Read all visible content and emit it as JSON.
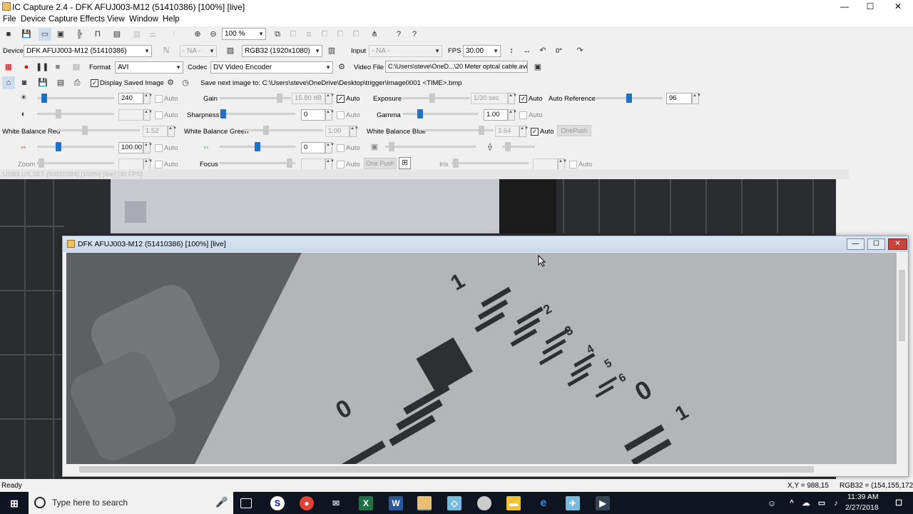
{
  "app": {
    "title": "IC Capture 2.4 - DFK AFUJ003-M12 (51410386) [100%]  [live]",
    "window_buttons": {
      "minimize": "—",
      "maximize": "☐",
      "close": "✕"
    }
  },
  "menu": [
    "File",
    "Device",
    "Capture",
    "Effects",
    "View",
    "Window",
    "Help"
  ],
  "toolbar1": {
    "zoom": "100 %"
  },
  "toolbar2": {
    "device_label": "Device",
    "device_value": "DFK AFUJ003-M12 (51410386)",
    "format_na": "- NA -",
    "color_format": "RGB32 (1920x1080)",
    "input_label": "Input",
    "input_value": "- NA -",
    "fps_label": "FPS",
    "fps_value": "30.00",
    "rotation": "0°"
  },
  "toolbar3": {
    "format_label": "Format",
    "format_value": "AVI",
    "codec_label": "Codec",
    "codec_value": "DV Video Encoder",
    "videofile_label": "Video File",
    "videofile_value": "C:\\Users\\steve\\OneD...\\20 Meter optcal cable.avi"
  },
  "toolbar4": {
    "display_saved": "Display Saved Image",
    "save_next": "Save next image to: C:\\Users\\steve\\OneDrive\\Desktop\\trigger\\Image0001 <TIME>.bmp"
  },
  "props": {
    "brightness_value": "240",
    "auto": "Auto",
    "gain_label": "Gain",
    "gain_value": "15.80 dB",
    "exposure_label": "Exposure",
    "exposure_value": "1/30 sec",
    "auto_ref_label": "Auto Reference",
    "auto_ref_value": "96",
    "sharpness_label": "Sharpness",
    "sharpness_value": "0",
    "gamma_label": "Gamma",
    "gamma_value": "1.00",
    "wb_red_label": "White Balance Red",
    "wb_red_value": "1.52",
    "wb_green_label": "White Balance Green",
    "wb_green_value": "1.00",
    "wb_blue_label": "White Balance Blue",
    "wb_blue_value": "3.64",
    "onepush": "OnePush",
    "saturation_value": "100.00",
    "hue_value": "0",
    "zoom_label": "Zoom",
    "focus_label": "Focus",
    "one_push": "One Push",
    "iris_label": "Iris"
  },
  "bg_window": {
    "title": "USB3 UX.SET (50010394) [100%] [live] [30 FPS]"
  },
  "fg_window": {
    "title": "DFK AFUJ003-M12 (51410386) [100%]  [live]"
  },
  "status": {
    "left": "Ready",
    "xy": "X,Y = 988,15",
    "rgb": "RGB32 = (154,155,172)"
  },
  "taskbar": {
    "search": "Type here to search",
    "time": "11:39 AM",
    "date": "2/27/2018"
  },
  "colors": {
    "accent": "#1a73c9",
    "taskbar": "#0f1520",
    "title_active": "#c9d8ec"
  }
}
